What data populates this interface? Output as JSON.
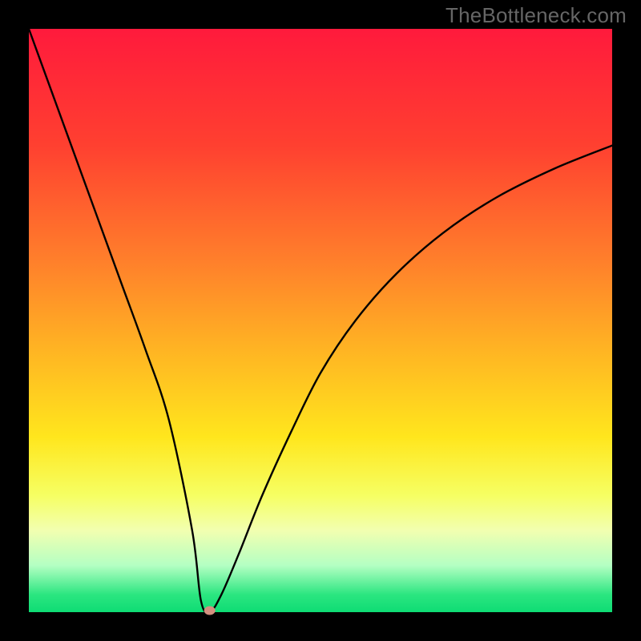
{
  "watermark": "TheBottleneck.com",
  "chart_data": {
    "type": "line",
    "title": "",
    "xlabel": "",
    "ylabel": "",
    "xlim": [
      0,
      100
    ],
    "ylim": [
      0,
      100
    ],
    "grid": false,
    "legend": false,
    "background": {
      "type": "vertical-gradient",
      "stops": [
        {
          "pos": 0.0,
          "color": "#ff1a3c"
        },
        {
          "pos": 0.2,
          "color": "#ff4030"
        },
        {
          "pos": 0.4,
          "color": "#ff802b"
        },
        {
          "pos": 0.55,
          "color": "#ffb423"
        },
        {
          "pos": 0.7,
          "color": "#ffe61d"
        },
        {
          "pos": 0.8,
          "color": "#f6ff63"
        },
        {
          "pos": 0.86,
          "color": "#f2ffb0"
        },
        {
          "pos": 0.92,
          "color": "#b4ffc3"
        },
        {
          "pos": 0.97,
          "color": "#2be680"
        },
        {
          "pos": 1.0,
          "color": "#0edc74"
        }
      ]
    },
    "series": [
      {
        "name": "curve",
        "x": [
          0,
          4,
          8,
          12,
          16,
          20,
          24,
          28,
          29.5,
          31,
          33,
          36,
          40,
          45,
          50,
          56,
          63,
          71,
          80,
          90,
          100
        ],
        "y": [
          100,
          89,
          78,
          67,
          56,
          45,
          33,
          14,
          2,
          0,
          3,
          10,
          20,
          31,
          41,
          50,
          58,
          65,
          71,
          76,
          80
        ]
      }
    ],
    "marker": {
      "x": 31,
      "y": 0,
      "color": "#d49080"
    }
  }
}
